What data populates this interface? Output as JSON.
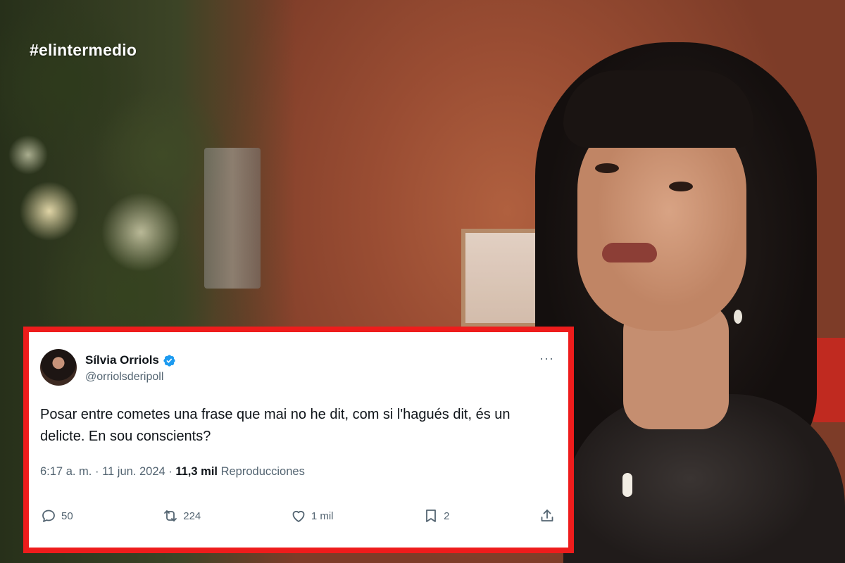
{
  "overlay": {
    "hashtag": "#elintermedio"
  },
  "tweet": {
    "author_name": "Sílvia Orriols",
    "handle": "@orriolsderipoll",
    "verified": true,
    "text": "Posar entre cometes una frase que mai no he dit, com si l'hagués dit, és un delicte. En sou conscients?",
    "time": "6:17 a. m.",
    "separator": "·",
    "date": "11 jun. 2024",
    "views_count": "11,3 mil",
    "views_label": "Reproducciones",
    "actions": {
      "reply": "50",
      "retweet": "224",
      "like": "1 mil",
      "bookmark": "2"
    }
  },
  "colors": {
    "card_border": "#ee1c1c",
    "verified_blue": "#1d9bf0",
    "muted_text": "#536471"
  },
  "icons": [
    "more-icon",
    "reply-icon",
    "retweet-icon",
    "like-icon",
    "bookmark-icon",
    "share-icon",
    "verified-badge-icon"
  ]
}
